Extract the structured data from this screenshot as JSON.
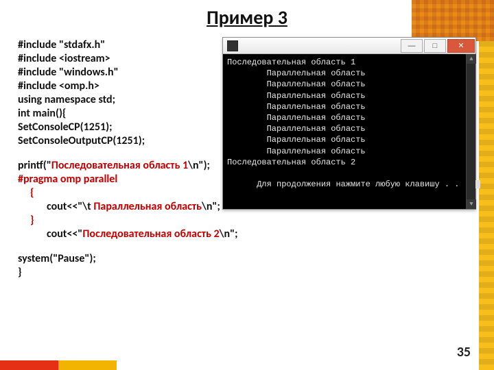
{
  "title": "Пример 3",
  "page_number": "35",
  "code": {
    "l1": "#include \"stdafx.h\"",
    "l2": "#include <iostream>",
    "l3": "#include \"windows.h\"",
    "l4": "#include <omp.h>",
    "l5": "using namespace std;",
    "l6": "int main(){",
    "l7": "SetConsoleCP(1251);",
    "l8": "SetConsoleOutputCP(1251);",
    "l9a": " printf(\"",
    "l9b": "Последовательная область 1",
    "l9c": "\\n\");",
    "l10": "#pragma omp parallel",
    "l11": "{",
    "l12a": "cout<<\"\\t ",
    "l12b": "Параллельная область",
    "l12c": "\\n\";",
    "l13": "}",
    "l14a": "cout<<\"",
    "l14b": "Последовательная область 2",
    "l14c": "\\n\";",
    "l15": "system(\"Pause\");",
    "l16": "}"
  },
  "console": {
    "lines": [
      "Последовательная область 1",
      "        Параллельная область",
      "        Параллельная область",
      "        Параллельная область",
      "        Параллельная область",
      "        Параллельная область",
      "        Параллельная область",
      "        Параллельная область",
      "        Параллельная область",
      "Последовательная область 2",
      "Для продолжения нажмите любую клавишу . . . "
    ],
    "btn_min": "—",
    "btn_max": "□",
    "btn_close": "✕"
  }
}
